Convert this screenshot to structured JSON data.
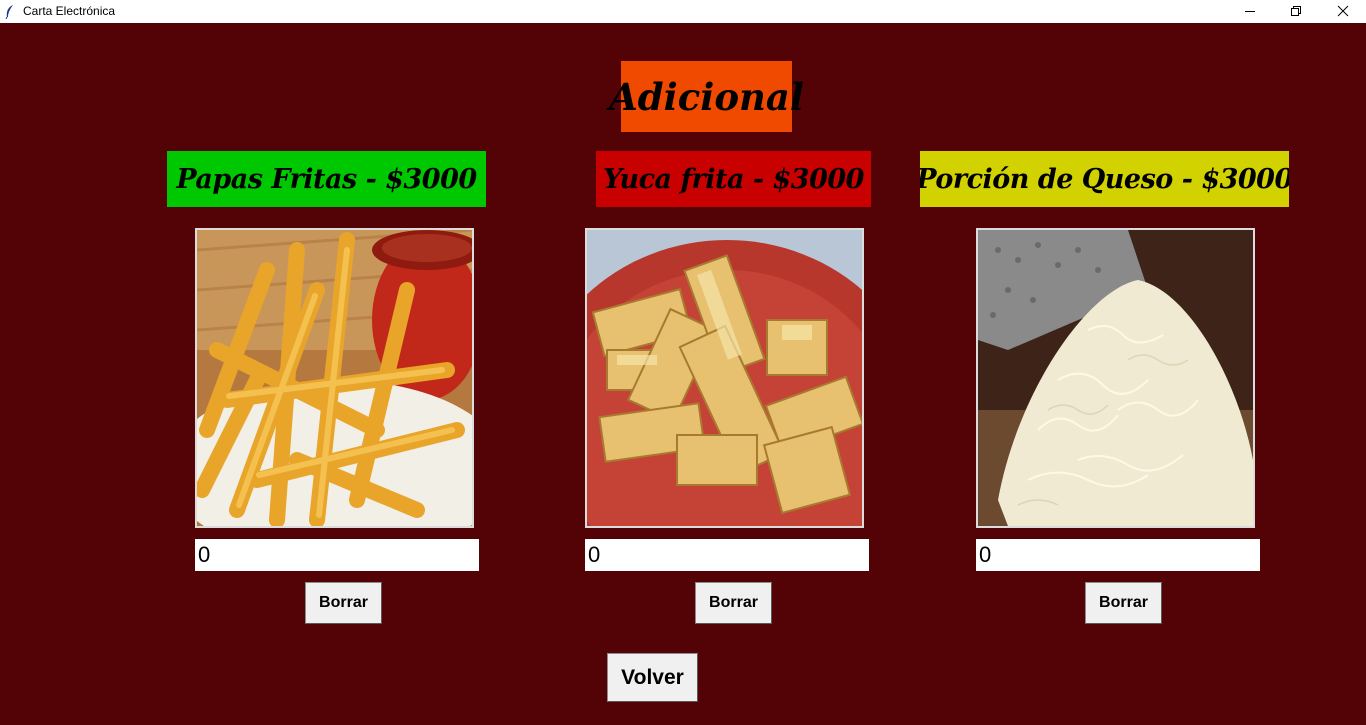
{
  "window": {
    "title": "Carta Electrónica",
    "controls": {
      "minimize": "minimize-icon",
      "maximize": "restore-icon",
      "close": "close-icon"
    }
  },
  "heading": {
    "text": "Adicional",
    "bg": "#f04a00"
  },
  "items": [
    {
      "label": "Papas Fritas - $3000",
      "label_bg": "#00c800",
      "photo": "french-fries-photo",
      "quantity": "0",
      "clear_label": "Borrar"
    },
    {
      "label": "Yuca frita - $3000",
      "label_bg": "#c80000",
      "photo": "fried-yuca-photo",
      "quantity": "0",
      "clear_label": "Borrar"
    },
    {
      "label": "Porción de Queso - $3000",
      "label_bg": "#d2d200",
      "photo": "grated-cheese-photo",
      "quantity": "0",
      "clear_label": "Borrar"
    }
  ],
  "back_button": {
    "label": "Volver"
  },
  "colors": {
    "background": "#530306"
  }
}
